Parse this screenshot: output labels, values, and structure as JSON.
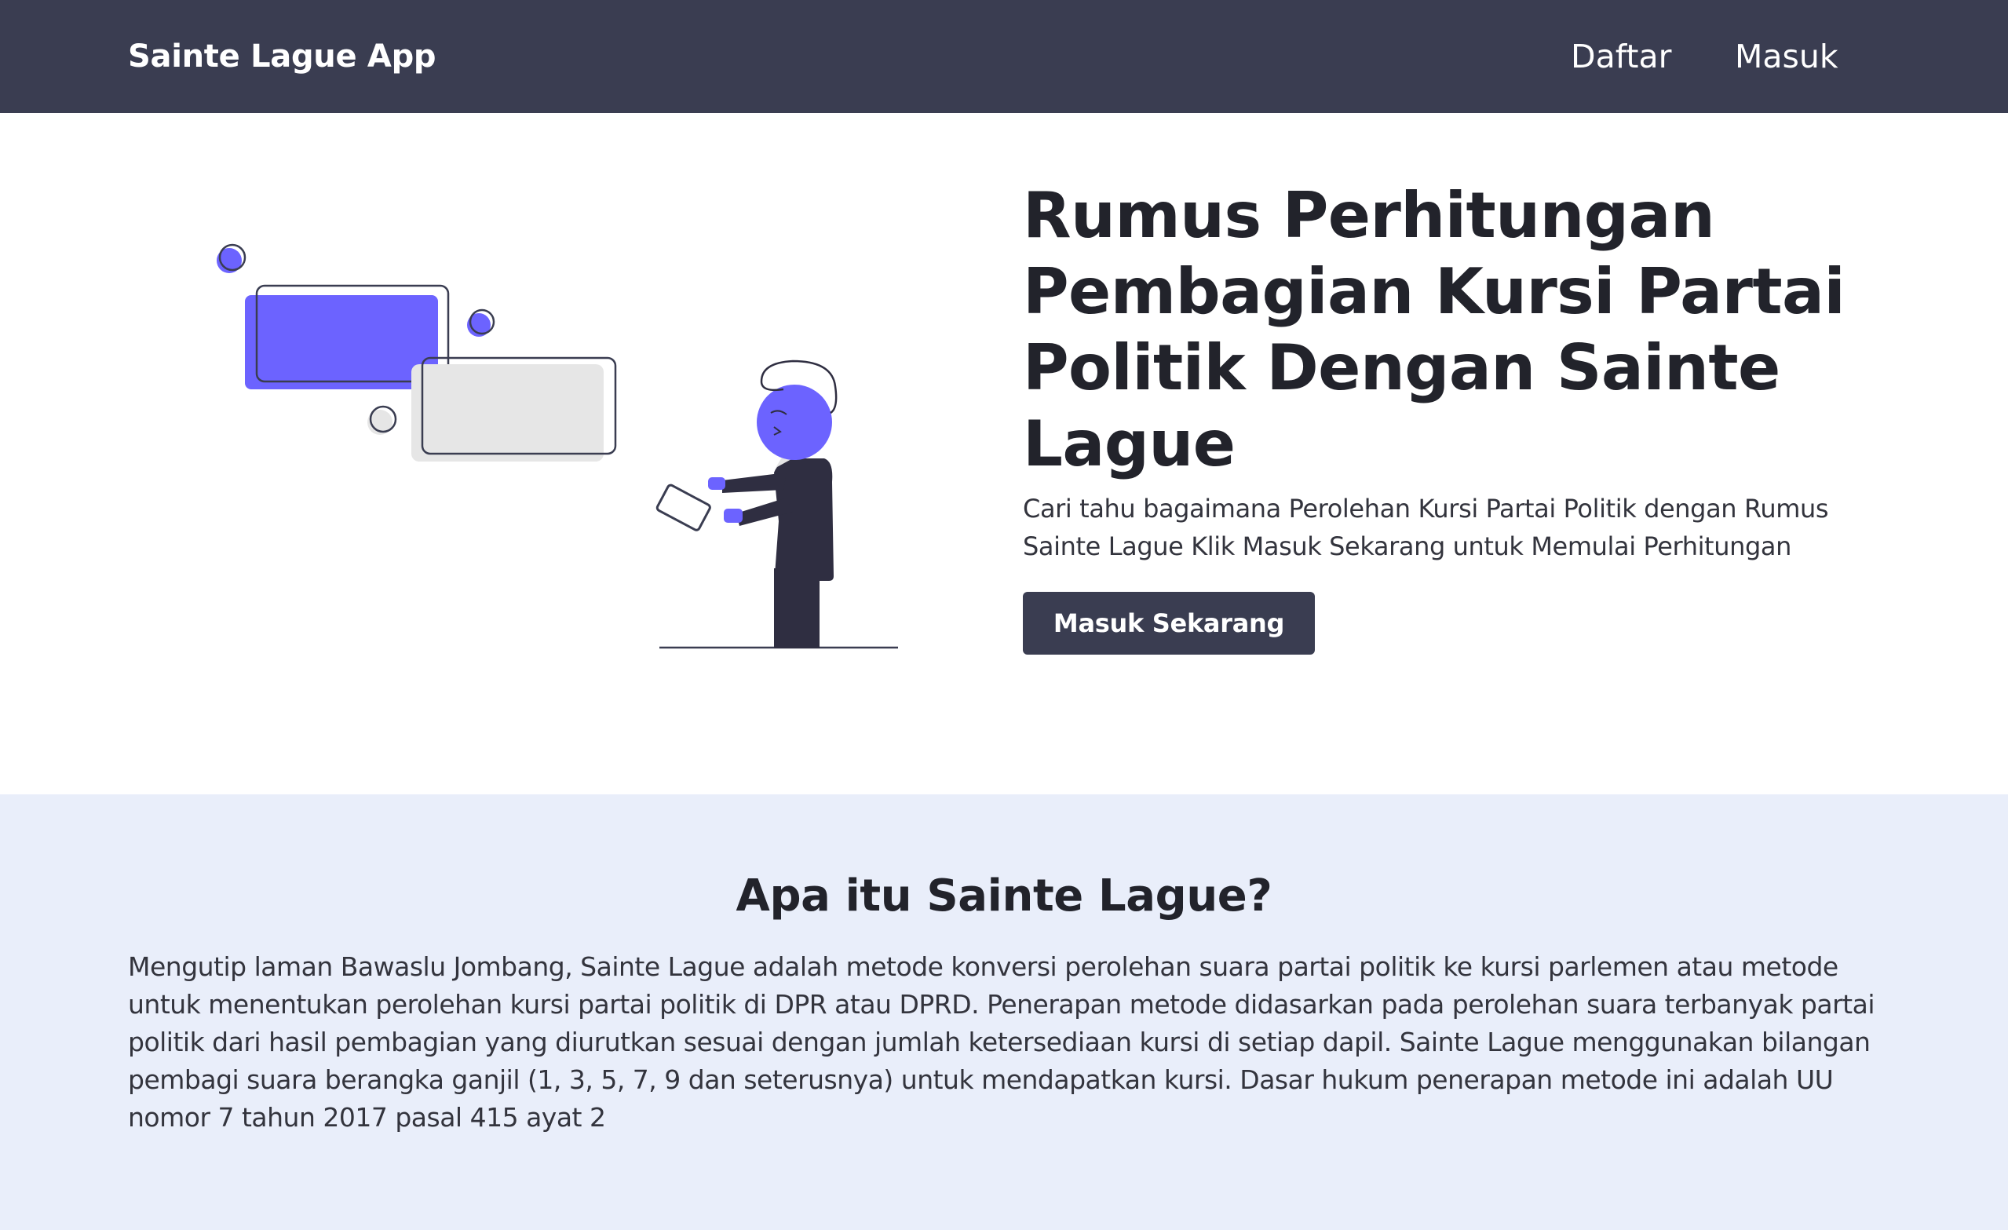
{
  "navbar": {
    "brand": "Sainte Lague App",
    "links": [
      {
        "label": "Daftar"
      },
      {
        "label": "Masuk"
      }
    ]
  },
  "hero": {
    "title": "Rumus Perhitungan Pembagian Kursi Partai Politik Dengan Sainte Lague",
    "subtitle": "Cari tahu bagaimana Perolehan Kursi Partai Politik dengan Rumus Sainte Lague Klik Masuk Sekarang untuk Memulai Perhitungan",
    "cta_label": "Masuk Sekarang"
  },
  "about": {
    "title": "Apa itu Sainte Lague?",
    "text": "Mengutip laman Bawaslu Jombang, Sainte Lague adalah metode konversi perolehan suara partai politik ke kursi parlemen atau metode untuk menentukan perolehan kursi partai politik di DPR atau DPRD. Penerapan metode didasarkan pada perolehan suara terbanyak partai politik dari hasil pembagian yang diurutkan sesuai dengan jumlah ketersediaan kursi di setiap dapil. Sainte Lague menggunakan bilangan pembagi suara berangka ganjil (1, 3, 5, 7, 9 dan seterusnya) untuk mendapatkan kursi. Dasar hukum penerapan metode ini adalah UU nomor 7 tahun 2017 pasal 415 ayat 2"
  },
  "colors": {
    "navbar_bg": "#3a3d51",
    "accent": "#6c63ff",
    "about_bg": "#e9eefa",
    "text_dark": "#22232b"
  },
  "icons": {
    "illustration": "person-reading-tablet-with-chat-bubbles-illustration"
  }
}
